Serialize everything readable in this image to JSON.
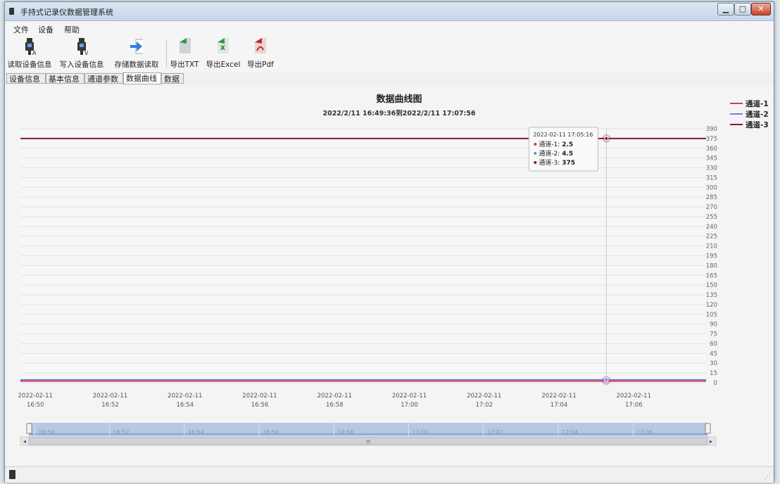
{
  "window": {
    "title": "手持式记录仪数据管理系统"
  },
  "menu": [
    "文件",
    "设备",
    "帮助"
  ],
  "toolbar": {
    "read_device": "读取设备信息",
    "write_device": "写入设备信息",
    "read_stored": "存储数据读取",
    "export_txt": "导出TXT",
    "export_excel": "导出Excel",
    "export_pdf": "导出Pdf"
  },
  "tabs": [
    "设备信息",
    "基本信息",
    "通道参数",
    "数据曲线",
    "数据"
  ],
  "active_tab": "数据曲线",
  "colors": {
    "ch1": "#e0364a",
    "ch2": "#7c7fd9",
    "ch3": "#7a1f34",
    "scroll_fill": "#a9c0e0",
    "scroll_line": "#6f8fd4"
  },
  "chart_data": {
    "type": "line",
    "title": "数据曲线图",
    "subtitle": "2022/2/11 16:49:36到2022/2/11 17:07:56",
    "ylim": [
      0,
      390
    ],
    "y_ticks": [
      "390",
      "375",
      "360",
      "345",
      "330",
      "315",
      "300",
      "285",
      "270",
      "255",
      "240",
      "225",
      "210",
      "195",
      "180",
      "165",
      "150",
      "135",
      "120",
      "105",
      "90",
      "75",
      "60",
      "45",
      "30",
      "15",
      "0"
    ],
    "x_ticks": [
      {
        "date": "2022-02-11",
        "time": "16:50"
      },
      {
        "date": "2022-02-11",
        "time": "16:52"
      },
      {
        "date": "2022-02-11",
        "time": "16:54"
      },
      {
        "date": "2022-02-11",
        "time": "16:56"
      },
      {
        "date": "2022-02-11",
        "time": "16:58"
      },
      {
        "date": "2022-02-11",
        "time": "17:00"
      },
      {
        "date": "2022-02-11",
        "time": "17:02"
      },
      {
        "date": "2022-02-11",
        "time": "17:04"
      },
      {
        "date": "2022-02-11",
        "time": "17:06"
      }
    ],
    "x_range": [
      "2022-02-11 16:49:36",
      "2022-02-11 17:07:56"
    ],
    "series": [
      {
        "name": "通道-1",
        "values": [
          2.5,
          2.5
        ]
      },
      {
        "name": "通道-2",
        "values": [
          4.5,
          4.5
        ]
      },
      {
        "name": "通道-3",
        "values": [
          375,
          375
        ]
      }
    ],
    "legend_position": "top-right",
    "tooltip": {
      "time": "2022-02-11 17:05:16",
      "rows": [
        {
          "label": "通道-1: ",
          "value": "2.5"
        },
        {
          "label": "通道-2: ",
          "value": "4.5"
        },
        {
          "label": "通道-3: ",
          "value": "375"
        }
      ]
    },
    "navigator_ticks": [
      "16:50",
      "16:52",
      "16:54",
      "16:56",
      "16:58",
      "17:00",
      "17:02",
      "17:04",
      "17:06"
    ],
    "scroll_glyph": "III"
  }
}
